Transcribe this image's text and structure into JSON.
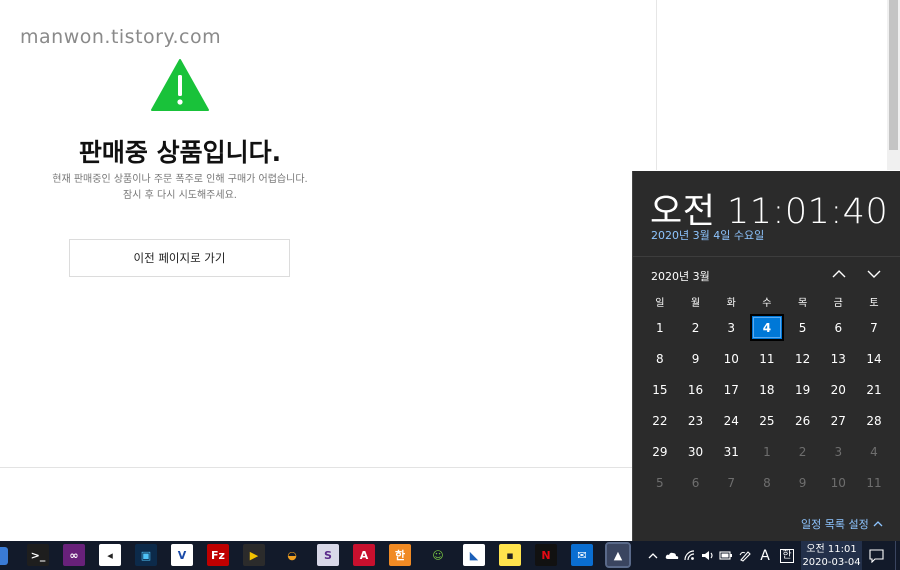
{
  "watermark": "manwon.tistory.com",
  "notice": {
    "title": "판매중 상품입니다.",
    "desc_line1": "현재 판매중인 상품이나 주문 폭주로 인해 구매가 어렵습니다.",
    "desc_line2": "잠시 후 다시 시도해주세요.",
    "back_button": "이전 페이지로 가기"
  },
  "flyout": {
    "clock": "오전 11:01:40",
    "full_date": "2020년 3월 4일 수요일",
    "month_label": "2020년 3월",
    "weekdays": [
      "일",
      "월",
      "화",
      "수",
      "목",
      "금",
      "토"
    ],
    "weeks": [
      [
        "1",
        "2",
        "3",
        "4",
        "5",
        "6",
        "7"
      ],
      [
        "8",
        "9",
        "10",
        "11",
        "12",
        "13",
        "14"
      ],
      [
        "15",
        "16",
        "17",
        "18",
        "19",
        "20",
        "21"
      ],
      [
        "22",
        "23",
        "24",
        "25",
        "26",
        "27",
        "28"
      ],
      [
        "29",
        "30",
        "31",
        "1",
        "2",
        "3",
        "4"
      ],
      [
        "5",
        "6",
        "7",
        "8",
        "9",
        "10",
        "11"
      ]
    ],
    "today": "4",
    "settings_link": "일정 목록 설정",
    "accent_color": "#0078d7"
  },
  "taskbar": {
    "apps": [
      {
        "name": "terminal-app-icon",
        "glyph": ">_",
        "bg": "#1e1e1e",
        "fg": "#ffffff"
      },
      {
        "name": "visual-studio-icon",
        "glyph": "∞",
        "bg": "#68217a",
        "fg": "#ffffff"
      },
      {
        "name": "capture-tool-icon",
        "glyph": "◂",
        "bg": "#ffffff",
        "fg": "#222222"
      },
      {
        "name": "video-editor-icon",
        "glyph": "▣",
        "bg": "#0c2a4a",
        "fg": "#4fc3f7"
      },
      {
        "name": "vector-app-icon",
        "glyph": "V",
        "bg": "#ffffff",
        "fg": "#1a4aa8"
      },
      {
        "name": "filezilla-icon",
        "glyph": "Fz",
        "bg": "#bf0000",
        "fg": "#ffffff"
      },
      {
        "name": "media-player-icon",
        "glyph": "▶",
        "bg": "#2b2b2b",
        "fg": "#f2c200"
      },
      {
        "name": "globe-app-icon",
        "glyph": "◒",
        "bg": "#121a2a",
        "fg": "#f0a020"
      },
      {
        "name": "s-app-icon",
        "glyph": "S",
        "bg": "#d8d8e8",
        "fg": "#5a2a8a"
      },
      {
        "name": "acrobat-icon",
        "glyph": "A",
        "bg": "#c8102e",
        "fg": "#ffffff"
      },
      {
        "name": "hwp-icon",
        "glyph": "한",
        "bg": "#f08a24",
        "fg": "#ffffff"
      },
      {
        "name": "frog-app-icon",
        "glyph": "☺",
        "bg": "#121a2a",
        "fg": "#7bc843"
      },
      {
        "name": "drawing-app-icon",
        "glyph": "◣",
        "bg": "#ffffff",
        "fg": "#1b5fb8"
      },
      {
        "name": "sticky-notes-icon",
        "glyph": "▪",
        "bg": "#ffe34d",
        "fg": "#222222"
      },
      {
        "name": "netflix-icon",
        "glyph": "N",
        "bg": "#111111",
        "fg": "#e50914"
      },
      {
        "name": "mail-icon",
        "glyph": "✉",
        "bg": "#0a6ed1",
        "fg": "#ffffff"
      },
      {
        "name": "photos-icon",
        "glyph": "▲",
        "bg": "#3a4560",
        "fg": "#ffffff"
      }
    ],
    "clock_time": "오전 11:01",
    "clock_date": "2020-03-04",
    "ime_label": "A",
    "ime_mode": "한"
  }
}
